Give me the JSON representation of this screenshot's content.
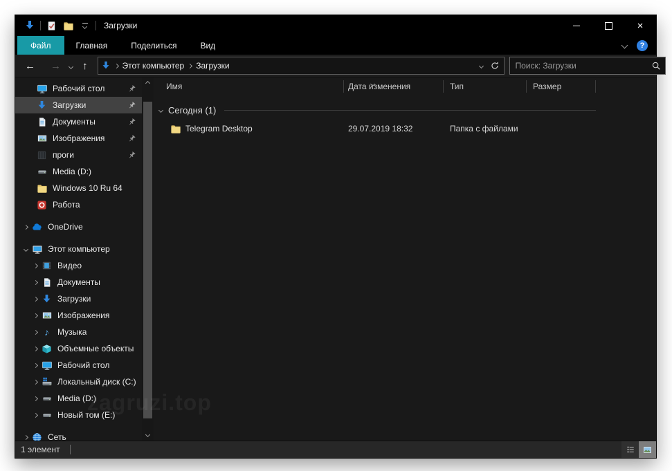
{
  "window": {
    "title": "Загрузки"
  },
  "icons": {
    "back": "←",
    "forward": "→",
    "up": "↑",
    "close": "×",
    "help": "?",
    "music_note": "♪"
  },
  "tabs": {
    "file": "Файл",
    "home": "Главная",
    "share": "Поделиться",
    "view": "Вид"
  },
  "navbar": {
    "breadcrumb_root": "Этот компьютер",
    "breadcrumb_current": "Загрузки",
    "search_placeholder": "Поиск: Загрузки"
  },
  "sidebar": {
    "quick_access": [
      {
        "label": "Рабочий стол"
      },
      {
        "label": "Загрузки"
      },
      {
        "label": "Документы"
      },
      {
        "label": "Изображения"
      },
      {
        "label": "проги"
      },
      {
        "label": "Media (D:)"
      },
      {
        "label": "Windows 10 Ru 64"
      },
      {
        "label": "Работа"
      }
    ],
    "onedrive_label": "OneDrive",
    "this_pc_label": "Этот компьютер",
    "this_pc_children": [
      {
        "label": "Видео"
      },
      {
        "label": "Документы"
      },
      {
        "label": "Загрузки"
      },
      {
        "label": "Изображения"
      },
      {
        "label": "Музыка"
      },
      {
        "label": "Объемные объекты"
      },
      {
        "label": "Рабочий стол"
      },
      {
        "label": "Локальный диск (C:)"
      },
      {
        "label": "Media (D:)"
      },
      {
        "label": "Новый том (E:)"
      }
    ],
    "network_label": "Сеть"
  },
  "main": {
    "columns": {
      "name": "Имя",
      "date": "Дата изменения",
      "type": "Тип",
      "size": "Размер"
    },
    "group_label": "Сегодня (1)",
    "rows": [
      {
        "name": "Telegram Desktop",
        "date": "29.07.2019 18:32",
        "type": "Папка с файлами",
        "size": ""
      }
    ]
  },
  "statusbar": {
    "items_count": "1 элемент"
  },
  "watermark": "zagruzi.top",
  "colors": {
    "accent_tab": "#189aa6",
    "selection_gray": "#424242",
    "folder_yellow": "#f2d882",
    "download_blue": "#2f86dd",
    "help_blue": "#2f7fe0",
    "window_bg": "#191919",
    "titlebar_bg": "#000000"
  }
}
